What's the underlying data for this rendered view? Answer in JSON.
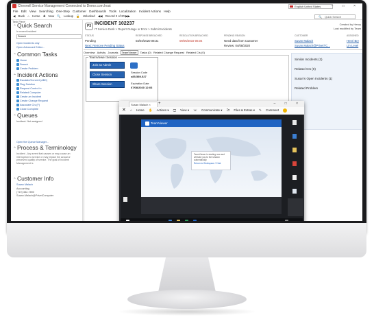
{
  "app": {
    "title": "Cherwell Service Management Connected to Demo.com.host",
    "language": "English United States",
    "window_controls": "–  □  ×",
    "menu": [
      "File",
      "Edit",
      "View",
      "Searching",
      "One-Step",
      "Customer",
      "Dashboards",
      "Tools",
      "Localization",
      "Incident Actions",
      "Help"
    ],
    "toolbar": [
      "Back",
      "Home",
      "New",
      "Lookup",
      "Unlocked",
      "Record 2 of 20"
    ],
    "search_placeholder": "Quick Search"
  },
  "taskpane": {
    "label": "Task Pane",
    "quick_search": {
      "title": "Quick Search",
      "scope": "In recent incident",
      "value": "Search",
      "option_open": "Open Incidents only",
      "option_advanced": "Open Advanced Editor..."
    },
    "common_tasks": {
      "title": "Common Tasks",
      "items": [
        "Home",
        "Search",
        "Create Problem"
      ]
    },
    "incident_actions": {
      "title": "Incident Actions",
      "items": [
        "Escalate/Convert (ABC)",
        "Flag Solution",
        "Request Control in",
        "Related Computer",
        "Create an Incident",
        "Create Change Request",
        "Associate CIs (F)",
        "Close Complete"
      ]
    },
    "queues": {
      "title": "Queues",
      "sub": "Incident: Not assigned",
      "link": "Open the Queue Manager..."
    },
    "process": {
      "title": "Process & Terminology",
      "text": "Incident - Any event that causes or may cause an interruption to service or may impact the actual or perceived quality of service. The goal of Incident Management is"
    },
    "customer_info": {
      "title": "Customer Info",
      "name": "Susan Malach",
      "lines": [
        "Accounting",
        "(719) 382-7890",
        "Susan.Malach@PrivetComputer"
      ]
    }
  },
  "incident": {
    "priority": "P3",
    "title": "INCIDENT 102237",
    "subtitle": "IT Service Desk > Report Outage or Error > Submit Incidents",
    "created_label": "Created by Henry",
    "modified_label": "Last modified by Team",
    "columns": [
      "STATUS",
      "RESPONSE BREACHED",
      "RESOLUTION BREACHED",
      "PENDING REASON",
      "CUSTOMER",
      "ASSIGNED"
    ],
    "row1": [
      "Pending",
      "03/04/2020 08:31",
      "09/06/2019 06:04",
      "Need data from Customer",
      "Susan Malach",
      "Henri Bry"
    ],
    "row2": [
      "Next: Remove Pending Status",
      "",
      "",
      "Review: 04/08/2020",
      "Susan.Malach@PrivetTC...",
      "Lin Level"
    ],
    "tabs": [
      "Overview",
      "Activity",
      "Journals",
      "TeamViewer",
      "Tasks (0)",
      "Related Change Request",
      "Related CIs (0)"
    ],
    "active_tab": "TeamViewer"
  },
  "teamviewer_session": {
    "legend": "TeamViewer Session",
    "buttons": [
      "Join as Admin",
      "Close Session",
      "Share Session"
    ],
    "session_code_label": "Session Code",
    "session_code": "s85-589-527",
    "expiration_label": "Expiration Date",
    "expiration": "07/08/2020 12:03"
  },
  "related": [
    "Similar Incidents (3)",
    "Related CIs (0)",
    "Susan's Open Incidents (1)",
    "Related Problem"
  ],
  "remote_window": {
    "tab_title": "Susan Malach",
    "tools": [
      "Home",
      "Actions",
      "View",
      "Communicate",
      "Files & Extras",
      "Comment"
    ],
    "app_name": "TeamViewer",
    "dialog_text": "TeamViewer is starting now and will take you to the session automatically.",
    "dialog_link": "Return to Workspace / Chat",
    "desktop_icons": [
      "Recycle",
      "Files",
      "Docs",
      "PDF",
      "Notes",
      "Chrome"
    ]
  }
}
